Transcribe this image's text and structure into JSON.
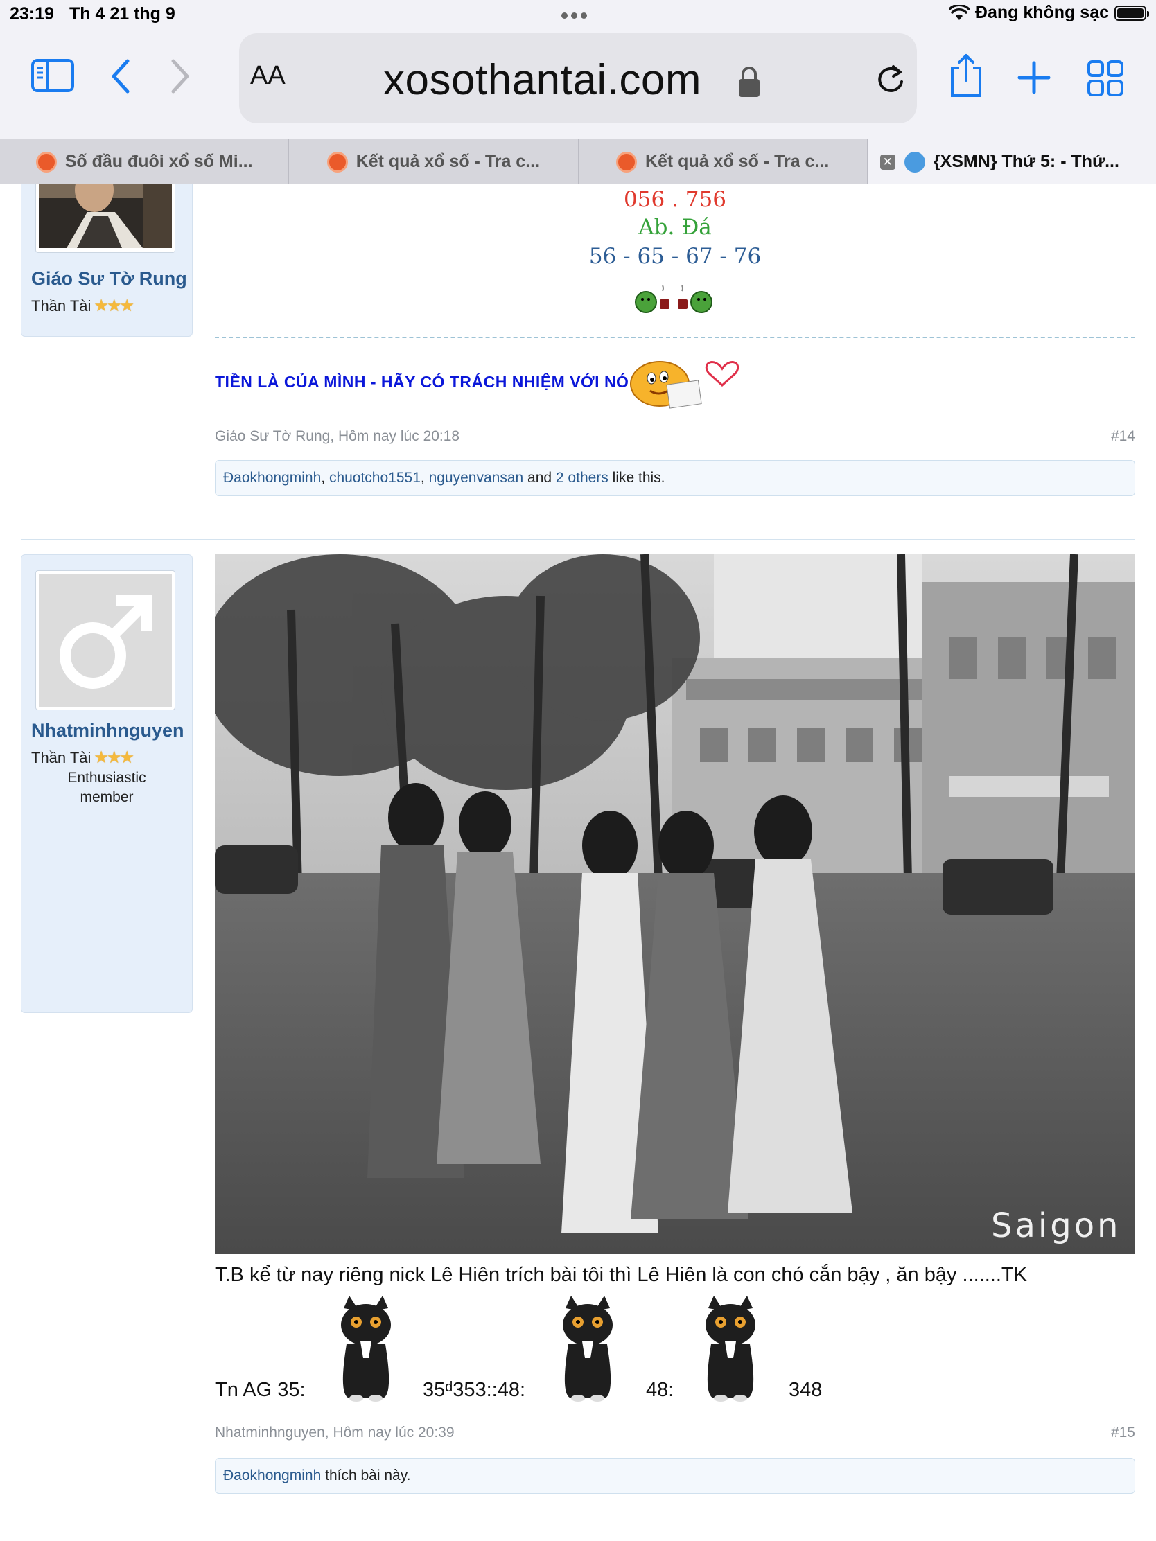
{
  "status": {
    "time": "23:19",
    "date": "Th 4 21 thg 9",
    "charging": "Đang không sạc"
  },
  "toolbar": {
    "text_size": "AA",
    "url": "xosothantai.com"
  },
  "tabs": [
    {
      "label": "Số đầu đuôi xổ số Mi...",
      "active": false
    },
    {
      "label": "Kết quả xổ số - Tra c...",
      "active": false
    },
    {
      "label": "Kết quả xổ số - Tra c...",
      "active": false
    },
    {
      "label": "{XSMN} Thứ 5: - Thứ...",
      "active": true
    }
  ],
  "post14": {
    "user": {
      "name": "Giáo Sư Tờ Rung",
      "title": "Thần Tài"
    },
    "lottery_lines": [
      {
        "text": "056 . 756",
        "color": "#e03a2e"
      },
      {
        "text": "Ab. Đá",
        "color": "#35a23a"
      },
      {
        "text": "56 - 65 - 67 - 76",
        "color": "#2d5d95"
      }
    ],
    "signature": "TIỀN LÀ CỦA MÌNH - HÃY CÓ TRÁCH NHIỆM VỚI NÓ",
    "meta": "Giáo Sư Tờ Rung, Hôm nay lúc 20:18",
    "number": "#14",
    "likes": {
      "users": [
        "Đaokhongminh",
        "chuotcho1551",
        "nguyenvansan"
      ],
      "and_text": "and",
      "others": "2 others",
      "suffix": "like this."
    }
  },
  "post15": {
    "user": {
      "name": "Nhatminhnguyen",
      "title": "Thần Tài",
      "rank": "Enthusiastic member"
    },
    "photo_watermark": "Saigon",
    "text": "T.B kể từ nay riêng nick Lê Hiên trích bài tôi thì Lê Hiên là con chó cắn bậy , ăn bậy .......TK",
    "tn_parts": [
      "Tn AG 35:",
      "35ᵈ353::48:",
      "48:",
      "348"
    ],
    "meta": "Nhatminhnguyen, Hôm nay lúc 20:39",
    "number": "#15",
    "likes": {
      "user": "Đaokhongminh",
      "suffix": "thích bài này."
    }
  },
  "colors": {
    "link": "#2a5a8e",
    "signature": "#0b17d9",
    "card_bg": "#e6effa"
  }
}
